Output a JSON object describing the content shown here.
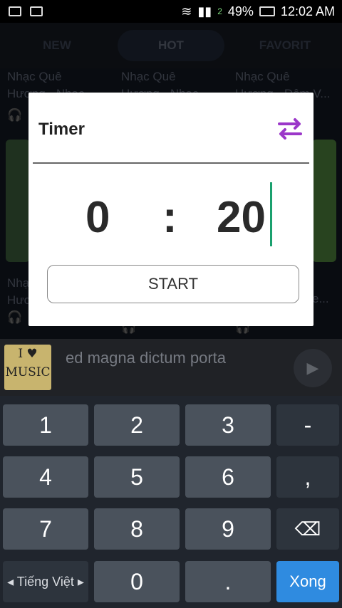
{
  "statusbar": {
    "battery": "49%",
    "time": "12:02 AM",
    "signal_label": "2"
  },
  "tabs": [
    {
      "label": "NEW"
    },
    {
      "label": "HOT"
    },
    {
      "label": "FAVORIT"
    }
  ],
  "songs": {
    "row1": [
      {
        "title": "Nhạc Quê\nHương - Nhạc"
      },
      {
        "title": "Nhạc Quê\nHương - Nhạc"
      },
      {
        "title": "Nhạc Quê\nHương - Đêm V..."
      }
    ],
    "row2": [
      {
        "title": "Nhạc Quê\nHươ"
      },
      {
        "title": ""
      },
      {
        "title": "e..."
      }
    ]
  },
  "player": {
    "logo_text_1": "I ♥",
    "logo_text_2": "MUSIC",
    "track": "ed magna dictum porta"
  },
  "dialog": {
    "title": "Timer",
    "hours": "0",
    "separator": ":",
    "minutes": "20",
    "start_label": "START"
  },
  "keyboard": {
    "rows": [
      [
        "1",
        "2",
        "3",
        "-"
      ],
      [
        "4",
        "5",
        "6",
        ","
      ],
      [
        "7",
        "8",
        "9",
        "⌫"
      ],
      [
        "◂ Tiếng Việt ▸",
        "0",
        ".",
        "Xong"
      ]
    ]
  }
}
